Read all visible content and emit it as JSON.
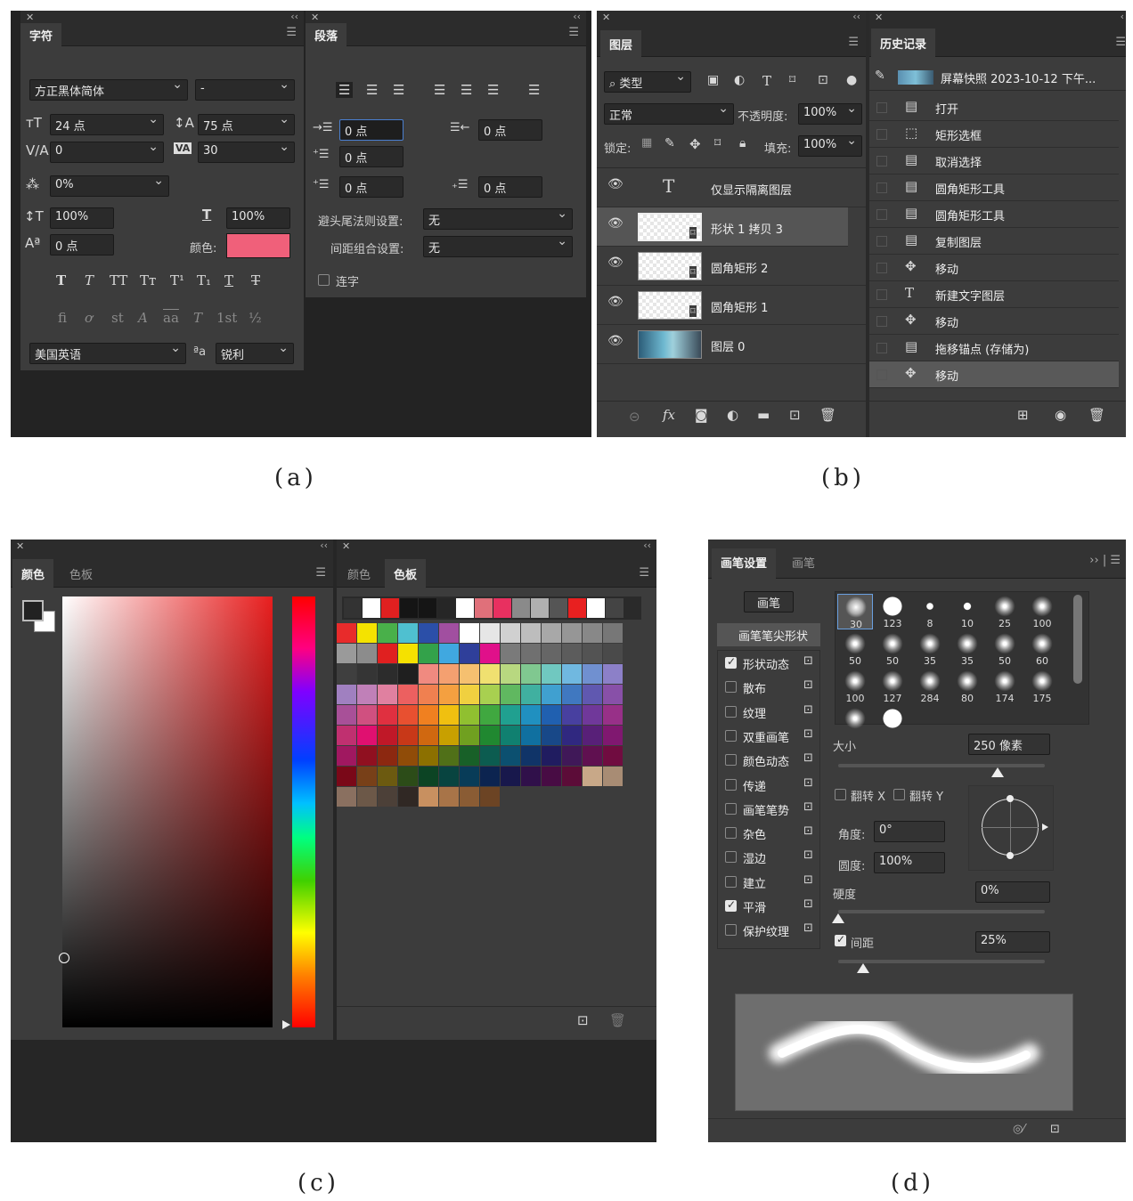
{
  "captions": {
    "a": "(a)",
    "b": "(b)",
    "c": "(c)",
    "d": "(d)"
  },
  "character": {
    "tab": "字符",
    "font_family": "方正黑体简体",
    "font_style": "-",
    "size": "24 点",
    "leading": "75 点",
    "kerning": "0",
    "tracking": "30",
    "tsume": "0%",
    "vscale": "100%",
    "hscale": "100%",
    "baseline": "0 点",
    "color_label": "颜色:",
    "color_value": "#f0607a",
    "style_row1": [
      "T",
      "T",
      "TT",
      "Tт",
      "T¹",
      "T₁",
      "T",
      "T"
    ],
    "style_row2": [
      "fi",
      "ơ",
      "st",
      "A",
      "aa",
      "T",
      "1st",
      "½"
    ],
    "language": "美国英语",
    "aa_label": "ªa",
    "antialias": "锐利"
  },
  "paragraph": {
    "tab": "段落",
    "indent_left": "0 点",
    "indent_right": "0 点",
    "indent_first": "0 点",
    "space_before": "0 点",
    "space_after": "0 点",
    "kinsoku_label": "避头尾法则设置:",
    "kinsoku_value": "无",
    "mojikumi_label": "间距组合设置:",
    "mojikumi_value": "无",
    "hyphenate_label": "连字"
  },
  "layers": {
    "tab": "图层",
    "filter_kind": "类型",
    "blend_mode": "正常",
    "opacity_label": "不透明度:",
    "opacity": "100%",
    "lock_label": "锁定:",
    "fill_label": "填充:",
    "fill": "100%",
    "items": [
      {
        "name": "仅显示隔离图层",
        "kind": "text"
      },
      {
        "name": "形状 1 拷贝 3",
        "kind": "shape",
        "selected": true
      },
      {
        "name": "圆角矩形 2",
        "kind": "shape"
      },
      {
        "name": "圆角矩形 1",
        "kind": "shape"
      },
      {
        "name": "图层 0",
        "kind": "image"
      }
    ]
  },
  "history": {
    "tab": "历史记录",
    "snapshot": "屏幕快照 2023-10-12 下午...",
    "items": [
      {
        "label": "打开",
        "icon": "doc"
      },
      {
        "label": "矩形选框",
        "icon": "marquee"
      },
      {
        "label": "取消选择",
        "icon": "doc"
      },
      {
        "label": "圆角矩形工具",
        "icon": "doc"
      },
      {
        "label": "圆角矩形工具",
        "icon": "doc"
      },
      {
        "label": "复制图层",
        "icon": "doc"
      },
      {
        "label": "移动",
        "icon": "move"
      },
      {
        "label": "新建文字图层",
        "icon": "text"
      },
      {
        "label": "移动",
        "icon": "move"
      },
      {
        "label": "拖移锚点 (存储为)",
        "icon": "doc"
      },
      {
        "label": "移动",
        "icon": "move",
        "selected": true
      }
    ]
  },
  "color_panel": {
    "tab_color": "颜色",
    "tab_swatches": "色板"
  },
  "swatches_panel": {
    "tab_color": "颜色",
    "tab_swatches": "色板",
    "recent": [
      "#333333",
      "#ffffff",
      "#e02020",
      "#151515",
      "#151515",
      "#262626",
      "#ffffff",
      "#e0707a",
      "#e83060",
      "#8a8a8a",
      "#b0b0b0",
      "#555555",
      "#e82020",
      "#ffffff",
      "#444444"
    ],
    "grid": [
      [
        "#e82b2b",
        "#f4e300",
        "#49b04a",
        "#4fc0d0",
        "#2b4fa8",
        "#a14fa0",
        "#ffffff",
        "#e6e6e6",
        "#d0d0d0",
        "#bdbdbd",
        "#a8a8a8",
        "#969696",
        "#888888",
        "#777777"
      ],
      [
        "#9a9a9a",
        "#8c8c8c",
        "#e02020",
        "#f5e100",
        "#33a24a",
        "#40a8e0",
        "#2f3f9a",
        "#e0108a",
        "#7a7a7a",
        "#707070",
        "#666666",
        "#5c5c5c",
        "#535353",
        "#4a4a4a"
      ],
      [
        "#3f3f3f",
        "#353535",
        "#2c2c2c",
        "#1f1f1f",
        "#f08a80",
        "#f4a070",
        "#f5c070",
        "#f0e070",
        "#b8d880",
        "#80c890",
        "#70c8c0",
        "#70b8e0",
        "#7090d0",
        "#8c80c8"
      ],
      [
        "#a080c0",
        "#c080b8",
        "#e080a0",
        "#ec6060",
        "#f08050",
        "#f4a040",
        "#f0d040",
        "#a8d050",
        "#60b860",
        "#40b0a0",
        "#40a0d0",
        "#4078c0",
        "#6058b0",
        "#8850a8"
      ],
      [
        "#a85098",
        "#d05080",
        "#e03040",
        "#e85030",
        "#f08020",
        "#f0c010",
        "#90c030",
        "#40a840",
        "#20a090",
        "#2090c0",
        "#2060b0",
        "#4840a0",
        "#70389a",
        "#983088"
      ],
      [
        "#c03070",
        "#e01070",
        "#c01828",
        "#c83818",
        "#d06810",
        "#c8a000",
        "#70a020",
        "#208830",
        "#108070",
        "#1070a0",
        "#184888",
        "#302880",
        "#582078",
        "#801870"
      ],
      [
        "#a01860",
        "#901020",
        "#8c2810",
        "#904c08",
        "#8c7000",
        "#507018",
        "#186028",
        "#0c5c50",
        "#0c5070",
        "#103468",
        "#201c60",
        "#401858",
        "#601050",
        "#700c40"
      ],
      [
        "#7a0818",
        "#784018",
        "#6c5a10",
        "#2c4c18",
        "#0c4424",
        "#084440",
        "#083c58",
        "#0c2450",
        "#18184c",
        "#30104a",
        "#480c44",
        "#5c0c38",
        "#c8a888",
        "#a88c74"
      ],
      [
        "#8a7060",
        "#6c5848",
        "#4c4038",
        "#302824",
        "#c89060",
        "#a87448",
        "#8a5c34",
        "#6c4424"
      ]
    ]
  },
  "brush": {
    "tab_settings": "画笔设置",
    "tab_brushes": "画笔",
    "brushes_button": "画笔",
    "tip_shape": "画笔笔尖形状",
    "options": [
      {
        "label": "形状动态",
        "checked": true
      },
      {
        "label": "散布",
        "checked": false
      },
      {
        "label": "纹理",
        "checked": false
      },
      {
        "label": "双重画笔",
        "checked": false
      },
      {
        "label": "颜色动态",
        "checked": false
      },
      {
        "label": "传递",
        "checked": false
      },
      {
        "label": "画笔笔势",
        "checked": false
      },
      {
        "label": "杂色",
        "checked": false
      },
      {
        "label": "湿边",
        "checked": false
      },
      {
        "label": "建立",
        "checked": false
      },
      {
        "label": "平滑",
        "checked": true
      },
      {
        "label": "保护纹理",
        "checked": false
      }
    ],
    "tips": [
      "30",
      "123",
      "8",
      "10",
      "25",
      "100",
      "50",
      "50",
      "35",
      "35",
      "50",
      "60",
      "100",
      "127",
      "284",
      "80",
      "174",
      "175",
      "",
      ""
    ],
    "size_label": "大小",
    "size": "250 像素",
    "flip_x": "翻转 X",
    "flip_y": "翻转 Y",
    "angle_label": "角度:",
    "angle": "0°",
    "roundness_label": "圆度:",
    "roundness": "100%",
    "hardness_label": "硬度",
    "hardness": "0%",
    "spacing_label": "间距",
    "spacing": "25%",
    "size_pct": 0.77,
    "hardness_pct": 0.0,
    "spacing_pct": 0.12
  }
}
